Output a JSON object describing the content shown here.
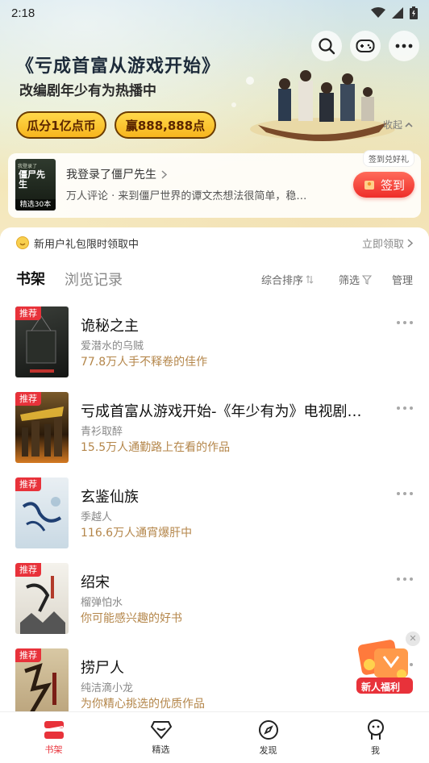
{
  "status_bar": {
    "time": "2:18"
  },
  "banner": {
    "title": "《亏成首富从游戏开始》",
    "subtitle": "改编剧年少有为热播中",
    "pill_left": "瓜分1亿点币",
    "pill_right": "赢888,888点",
    "collapse_label": "收起"
  },
  "continue_reading": {
    "cover_top": "我登录了",
    "cover_title": "僵尸先生",
    "cover_badge": "精选30本",
    "title": "我登录了僵尸先生",
    "description": "万人评论 · 来到僵尸世界的谭文杰想法很简单，稳…",
    "sign_tip": "签到兑好礼",
    "sign_label": "签到"
  },
  "gift_bar": {
    "text": "新用户礼包限时领取中",
    "action": "立即领取"
  },
  "tabs": {
    "shelf": "书架",
    "history": "浏览记录"
  },
  "tools": {
    "sort": "综合排序",
    "filter": "筛选",
    "manage": "管理"
  },
  "books": [
    {
      "tag": "推荐",
      "title": "诡秘之主",
      "author": "爱潜水的乌贼",
      "note": "77.8万人手不释卷的佳作",
      "cover_text": ""
    },
    {
      "tag": "推荐",
      "title": "亏成首富从游戏开始-《年少有为》电视剧…",
      "author": "青衫取醉",
      "note": "15.5万人通勤路上在看的作品",
      "cover_text": ""
    },
    {
      "tag": "推荐",
      "title": "玄鉴仙族",
      "author": "季越人",
      "note": "116.6万人通宵爆肝中",
      "cover_text": ""
    },
    {
      "tag": "推荐",
      "title": "绍宋",
      "author": "榴弹怕水",
      "note": "你可能感兴趣的好书",
      "cover_text": ""
    },
    {
      "tag": "推荐",
      "title": "捞尸人",
      "author": "纯洁滴小龙",
      "note": "为你精心挑选的优质作品",
      "cover_text": ""
    }
  ],
  "welfare": {
    "label": "新人福利"
  },
  "bottom_nav": [
    {
      "label": "书架",
      "icon": "bookshelf-icon",
      "active": true
    },
    {
      "label": "精选",
      "icon": "diamond-icon",
      "active": false
    },
    {
      "label": "发现",
      "icon": "compass-icon",
      "active": false
    },
    {
      "label": "我",
      "icon": "profile-icon",
      "active": false
    }
  ],
  "colors": {
    "accent": "#e8323a",
    "note": "#b4864a",
    "pill": "#f7b51e"
  }
}
